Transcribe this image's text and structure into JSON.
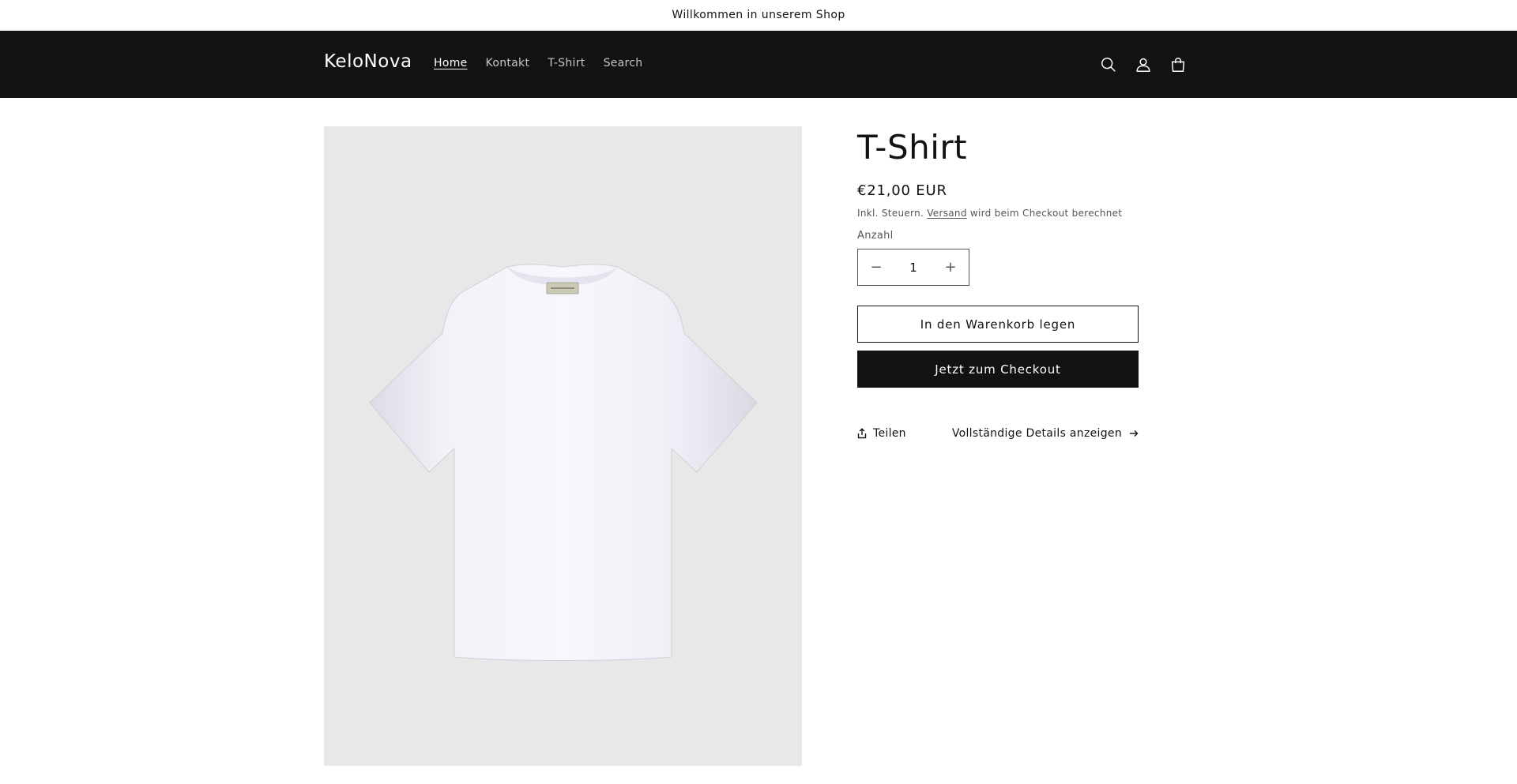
{
  "announcement": {
    "text": "Willkommen in unserem Shop"
  },
  "header": {
    "logo": "KeloNova",
    "nav": [
      {
        "label": "Home",
        "active": true
      },
      {
        "label": "Kontakt",
        "active": false
      },
      {
        "label": "T-Shirt",
        "active": false
      },
      {
        "label": "Search",
        "active": false
      }
    ],
    "icons": [
      "search-icon",
      "account-icon",
      "cart-icon"
    ]
  },
  "product": {
    "title": "T-Shirt",
    "price": "€21,00 EUR",
    "tax_prefix": "Inkl. Steuern.",
    "tax_link": "Versand",
    "tax_suffix": "wird beim Checkout berechnet",
    "quantity_label": "Anzahl",
    "quantity_value": "1",
    "decrease_symbol": "−",
    "increase_symbol": "+",
    "add_to_cart": "In den Warenkorb legen",
    "buy_now": "Jetzt zum Checkout",
    "share": "Teilen",
    "details": "Vollständige Details anzeigen",
    "image": "white-tshirt-image"
  },
  "colors": {
    "header_bg": "#121212",
    "image_bg": "#e8e8e8",
    "text": "#121212"
  }
}
